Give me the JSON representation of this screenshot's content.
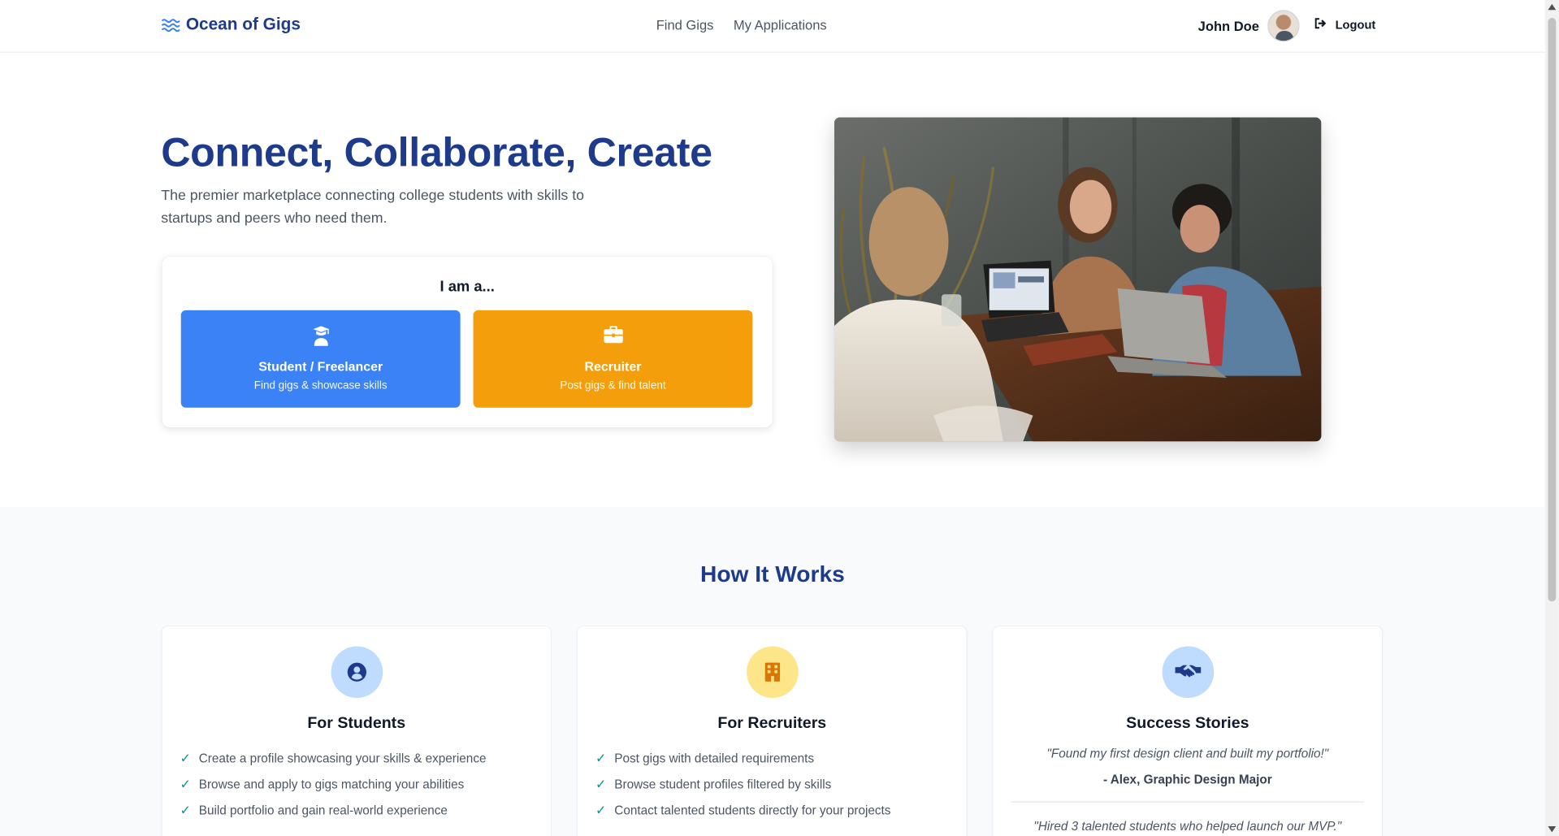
{
  "nav": {
    "brand": "Ocean of Gigs",
    "links": [
      "Find Gigs",
      "My Applications"
    ],
    "user_name": "John Doe",
    "logout_label": "Logout"
  },
  "hero": {
    "title": "Connect, Collaborate, Create",
    "subtitle": "The premier marketplace connecting college students with skills to startups and peers who need them.",
    "role_prompt": "I am a...",
    "student": {
      "title": "Student / Freelancer",
      "desc": "Find gigs & showcase skills"
    },
    "recruiter": {
      "title": "Recruiter",
      "desc": "Post gigs & find talent"
    }
  },
  "how": {
    "title": "How It Works",
    "students": {
      "title": "For Students",
      "items": [
        "Create a profile showcasing your skills & experience",
        "Browse and apply to gigs matching your abilities",
        "Build portfolio and gain real-world experience"
      ]
    },
    "recruiters": {
      "title": "For Recruiters",
      "items": [
        "Post gigs with detailed requirements",
        "Browse student profiles filtered by skills",
        "Contact talented students directly for your projects"
      ]
    },
    "stories": {
      "title": "Success Stories",
      "quote1": "\"Found my first design client and built my portfolio!\"",
      "author1": "- Alex, Graphic Design Major",
      "quote2": "\"Hired 3 talented students who helped launch our MVP.\""
    }
  },
  "colors": {
    "primary": "#1e3a8a",
    "student_btn": "#3b82f6",
    "recruiter_btn": "#f59e0b",
    "check": "#0d9488"
  },
  "icons": [
    "waves-icon",
    "avatar",
    "logout-icon",
    "graduation-cap-icon",
    "briefcase-icon",
    "user-circle-icon",
    "building-icon",
    "handshake-icon",
    "check-icon"
  ]
}
